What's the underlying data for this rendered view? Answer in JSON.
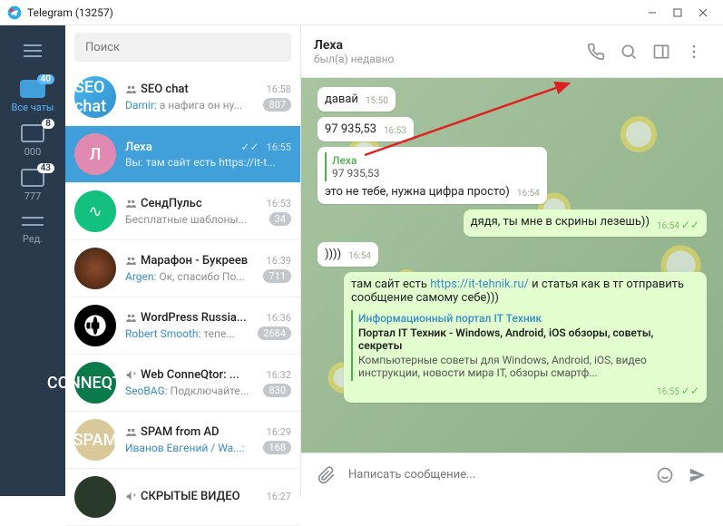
{
  "window": {
    "title": "Telegram (13257)"
  },
  "rail": {
    "all_chats": {
      "label": "Все чаты",
      "badge": "40"
    },
    "folder1": {
      "label": "000",
      "badge": "8"
    },
    "folder2": {
      "label": "777",
      "badge": "43"
    },
    "edit": {
      "label": "Ред."
    }
  },
  "search": {
    "placeholder": "Поиск"
  },
  "chats": [
    {
      "name": "SEO chat",
      "time": "16:58",
      "sender": "Damir",
      "preview": "а нафига он ну...",
      "badge": "807",
      "group": true
    },
    {
      "name": "Леха",
      "time": "16:55",
      "sender": "Вы",
      "preview": "там сайт есть https://it-t...",
      "checks": true,
      "selected": true
    },
    {
      "name": "СендПульс",
      "time": "16:53",
      "preview": "Бесплатные шаблоны...",
      "badge": "34",
      "group": true
    },
    {
      "name": "Марафон - Букреев",
      "time": "16:39",
      "sender": "Argen",
      "preview": "Ок, спасибо По...",
      "badge": "711",
      "group": true
    },
    {
      "name": "WordPress Russia...",
      "time": "16:36",
      "sender": "Robert Smooth",
      "preview": "тепе...",
      "badge": "2684",
      "group": true
    },
    {
      "name": "Web ConneQtor: ...",
      "time": "16:32",
      "sender": "SeoBAG",
      "preview": "Подключайте...",
      "badge": "830",
      "channel": true
    },
    {
      "name": "SPAM from AD",
      "time": "16:29",
      "sender": "Иванов Евгений / Wa...",
      "preview": "",
      "badge": "168",
      "group": true
    },
    {
      "name": "СКРЫТЫЕ ВИДЕО",
      "time": "16:27",
      "channel": true
    }
  ],
  "header": {
    "name": "Леха",
    "status": "был(а) недавно"
  },
  "messages": {
    "m1": {
      "text": "давай",
      "time": "15:50"
    },
    "m2": {
      "text": "97 935,53",
      "time": "16:53"
    },
    "m3": {
      "reply_name": "Леха",
      "reply_text": "97 935,53",
      "text": "это не тебе, нужна цифра просто)",
      "time": "16:54"
    },
    "m4": {
      "text": "дядя, ты мне в скрины лезешь))",
      "time": "16:54"
    },
    "m5": {
      "text": "))))",
      "time": "16:54"
    },
    "m6": {
      "text_before": "там сайт есть ",
      "link": "https://it-tehnik.ru/",
      "text_after": " и статья как в тг отправить сообщение самому себе)))",
      "card_title": "Информационный портал IT Техник",
      "card_head": "Портал IT Техник - Windows, Android, iOS обзоры, советы, секреты",
      "card_desc": "Компьютерные советы для Windows, Android, iOS, видео инструкции, новости мира IT, обзоры смартф...",
      "time": "16:55"
    }
  },
  "composer": {
    "placeholder": "Написать сообщение..."
  }
}
